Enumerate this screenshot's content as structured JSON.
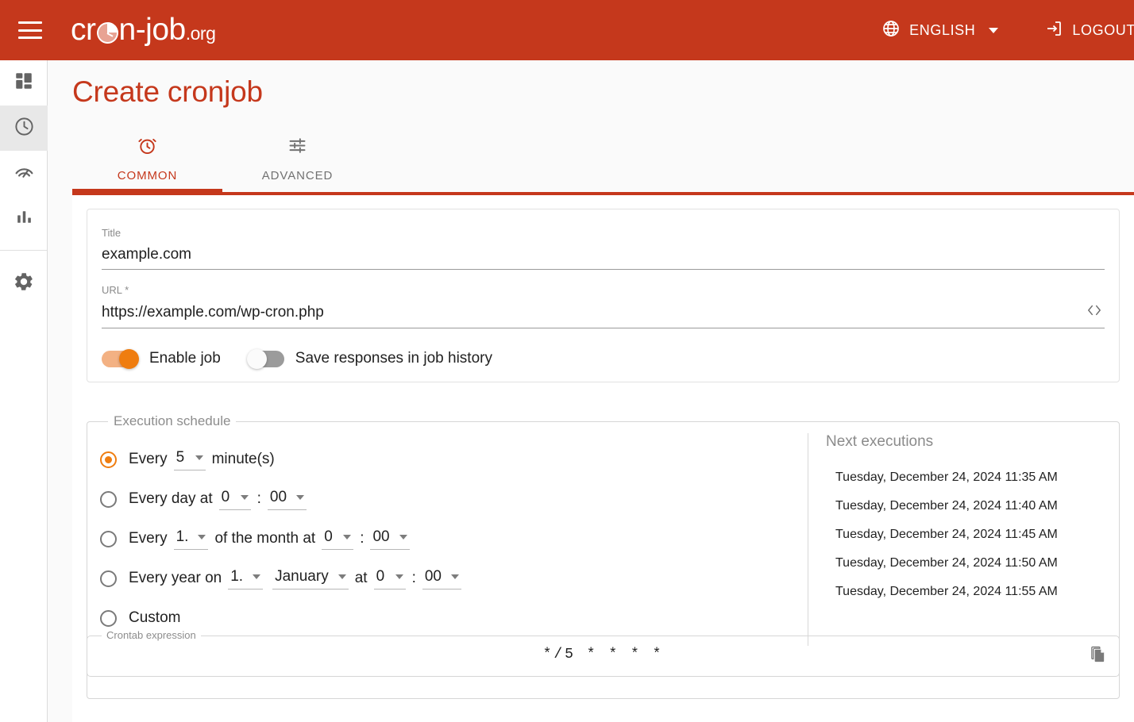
{
  "header": {
    "menu_icon": "hamburger-menu-icon",
    "logo_main": "cron-job",
    "logo_suffix": ".org",
    "language_icon": "globe-icon",
    "language_label": "ENGLISH",
    "logout_icon": "logout-icon",
    "logout_label": "LOGOUT",
    "brand_color": "#c5381c"
  },
  "sidebar": {
    "items": [
      {
        "name": "dashboard",
        "icon": "dashboard-grid-icon",
        "active": false
      },
      {
        "name": "cronjobs",
        "icon": "clock-icon",
        "active": true
      },
      {
        "name": "status",
        "icon": "speedometer-icon",
        "active": false
      },
      {
        "name": "statistics",
        "icon": "bar-chart-icon",
        "active": false
      },
      {
        "name": "settings",
        "icon": "gear-icon",
        "active": false
      }
    ]
  },
  "page": {
    "title": "Create cronjob"
  },
  "tabs": [
    {
      "label": "COMMON",
      "icon": "alarm-clock-icon",
      "active": true
    },
    {
      "label": "ADVANCED",
      "icon": "tune-sliders-icon",
      "active": false
    }
  ],
  "form": {
    "title_label": "Title",
    "title_value": "example.com",
    "title_placeholder": "Title",
    "url_label": "URL *",
    "url_value": "https://example.com/wp-cron.php",
    "url_placeholder": "URL",
    "url_action_icon": "code-brackets-icon",
    "enable_job_label": "Enable job",
    "enable_job_state": "on",
    "save_responses_label": "Save responses in job history",
    "save_responses_state": "off"
  },
  "schedule": {
    "legend": "Execution schedule",
    "options": [
      {
        "selected": true,
        "prefix": "Every",
        "selects": [
          {
            "value": "5"
          }
        ],
        "suffix": "minute(s)"
      },
      {
        "selected": false,
        "prefix": "Every day at",
        "selects": [
          {
            "value": "0"
          },
          {
            "value": "00"
          }
        ],
        "separator": ":",
        "suffix": ""
      },
      {
        "selected": false,
        "prefix": "Every",
        "selects": [
          {
            "value": "1."
          },
          {
            "value": "0"
          },
          {
            "value": "00"
          }
        ],
        "mid": "of the month at",
        "separator": ":",
        "suffix": ""
      },
      {
        "selected": false,
        "prefix": "Every year on",
        "selects": [
          {
            "value": "1."
          },
          {
            "value": "January"
          },
          {
            "value": "0"
          },
          {
            "value": "00"
          }
        ],
        "mid": "at",
        "separator": ":",
        "suffix": ""
      },
      {
        "selected": false,
        "prefix": "Custom",
        "selects": [],
        "suffix": ""
      }
    ],
    "next_executions_title": "Next executions",
    "next_executions": [
      "Tuesday, December 24, 2024 11:35 AM",
      "Tuesday, December 24, 2024 11:40 AM",
      "Tuesday, December 24, 2024 11:45 AM",
      "Tuesday, December 24, 2024 11:50 AM",
      "Tuesday, December 24, 2024 11:55 AM"
    ]
  },
  "crontab": {
    "legend": "Crontab expression",
    "value": "*/5 * * * *",
    "copy_icon": "copy-icon"
  }
}
